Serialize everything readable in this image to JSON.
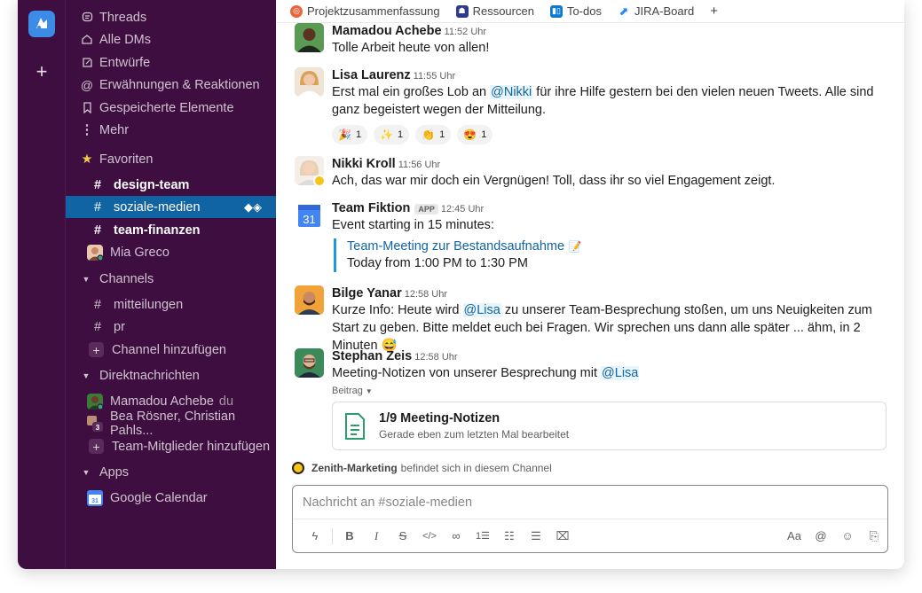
{
  "sidebar": {
    "nav": [
      {
        "label": "Threads",
        "icon": "threads-icon"
      },
      {
        "label": "Alle DMs",
        "icon": "dms-icon"
      },
      {
        "label": "Entwürfe",
        "icon": "drafts-icon"
      },
      {
        "label": "Erwähnungen & Reaktionen",
        "icon": "at-icon"
      },
      {
        "label": "Gespeicherte Elemente",
        "icon": "bookmark-icon"
      },
      {
        "label": "Mehr",
        "icon": "more-vertical-icon"
      }
    ],
    "favorites_label": "Favoriten",
    "favorites": [
      {
        "label": "design-team"
      },
      {
        "label": "soziale-medien"
      },
      {
        "label": "team-finanzen"
      }
    ],
    "favorite_dm": "Mia Greco",
    "channels_label": "Channels",
    "channels": [
      {
        "label": "mitteilungen"
      },
      {
        "label": "pr"
      }
    ],
    "add_channel": "Channel hinzufügen",
    "dms_label": "Direktnachrichten",
    "dms": [
      {
        "label": "Mamadou Achebe",
        "suffix": "du"
      },
      {
        "label": "Bea Rösner, Christian Pahls...",
        "count": "3"
      }
    ],
    "add_members": "Team-Mitglieder hinzufügen",
    "apps_label": "Apps",
    "apps": [
      {
        "label": "Google Calendar"
      }
    ]
  },
  "tabs": [
    {
      "label": "Projektzusammenfassung",
      "icon": "canvas-icon",
      "color": "#e8663d"
    },
    {
      "label": "Ressourcen",
      "icon": "resources-icon",
      "color": "#2e3a8c"
    },
    {
      "label": "To-dos",
      "icon": "trello-icon",
      "color": "#0b79d0"
    },
    {
      "label": "JIRA-Board",
      "icon": "jira-icon",
      "color": "#2684ff"
    }
  ],
  "messages": {
    "m1": {
      "name": "Mamadou Achebe",
      "time": "11:52 Uhr",
      "text": "Tolle Arbeit heute von allen!"
    },
    "m2": {
      "name": "Lisa Laurenz",
      "time": "11:55 Uhr",
      "text_before": "Erst mal ein großes Lob an ",
      "mention": "@Nikki",
      "text_after": " für ihre Hilfe gestern bei den vielen neuen Tweets. Alle sind ganz begeistert wegen der Mitteilung.",
      "reactions": [
        {
          "emoji": "🎉",
          "count": "1"
        },
        {
          "emoji": "✨",
          "count": "1"
        },
        {
          "emoji": "👏",
          "count": "1"
        },
        {
          "emoji": "😍",
          "count": "1"
        }
      ]
    },
    "m3": {
      "name": "Nikki Kroll",
      "time": "11:56 Uhr",
      "text": "Ach, das war mir doch ein Vergnügen! Toll, dass ihr so viel Engagement zeigt."
    },
    "m4": {
      "name": "Team Fiktion",
      "badge": "APP",
      "time": "12:45 Uhr",
      "text": "Event starting in 15 minutes:",
      "event_title": "Team-Meeting zur Bestandsaufnahme",
      "event_emoji": "📝",
      "event_time": "Today from 1:00 PM to 1:30 PM",
      "calendar_day": "31"
    },
    "m5": {
      "name": "Bilge Yanar",
      "time": "12:58 Uhr",
      "text_before": "Kurze Info: Heute wird ",
      "mention": "@Lisa",
      "text_after": " zu unserer Team-Besprechung stoßen, um uns Neuigkeiten zum Start zu geben. Bitte meldet euch bei Fragen. Wir sprechen uns dann alle später ... ähm, in 2 Minuten",
      "emoji": "😅"
    },
    "m6": {
      "name": "Stephan Zeis",
      "time": "12:58 Uhr",
      "text_before": "Meeting-Notizen von unserer Besprechung mit ",
      "mention": "@Lisa",
      "attachment_label": "Beitrag",
      "file_title": "1/9 Meeting-Notizen",
      "file_subtitle": "Gerade eben zum letzten Mal bearbeitet"
    }
  },
  "presence": {
    "name": "Zenith-Marketing",
    "text": "befindet sich in diesem Channel"
  },
  "composer": {
    "placeholder": "Nachricht an #soziale-medien"
  },
  "colors": {
    "sidebar": "#3f0e40",
    "active": "#1164a3",
    "link": "#1264a3"
  }
}
